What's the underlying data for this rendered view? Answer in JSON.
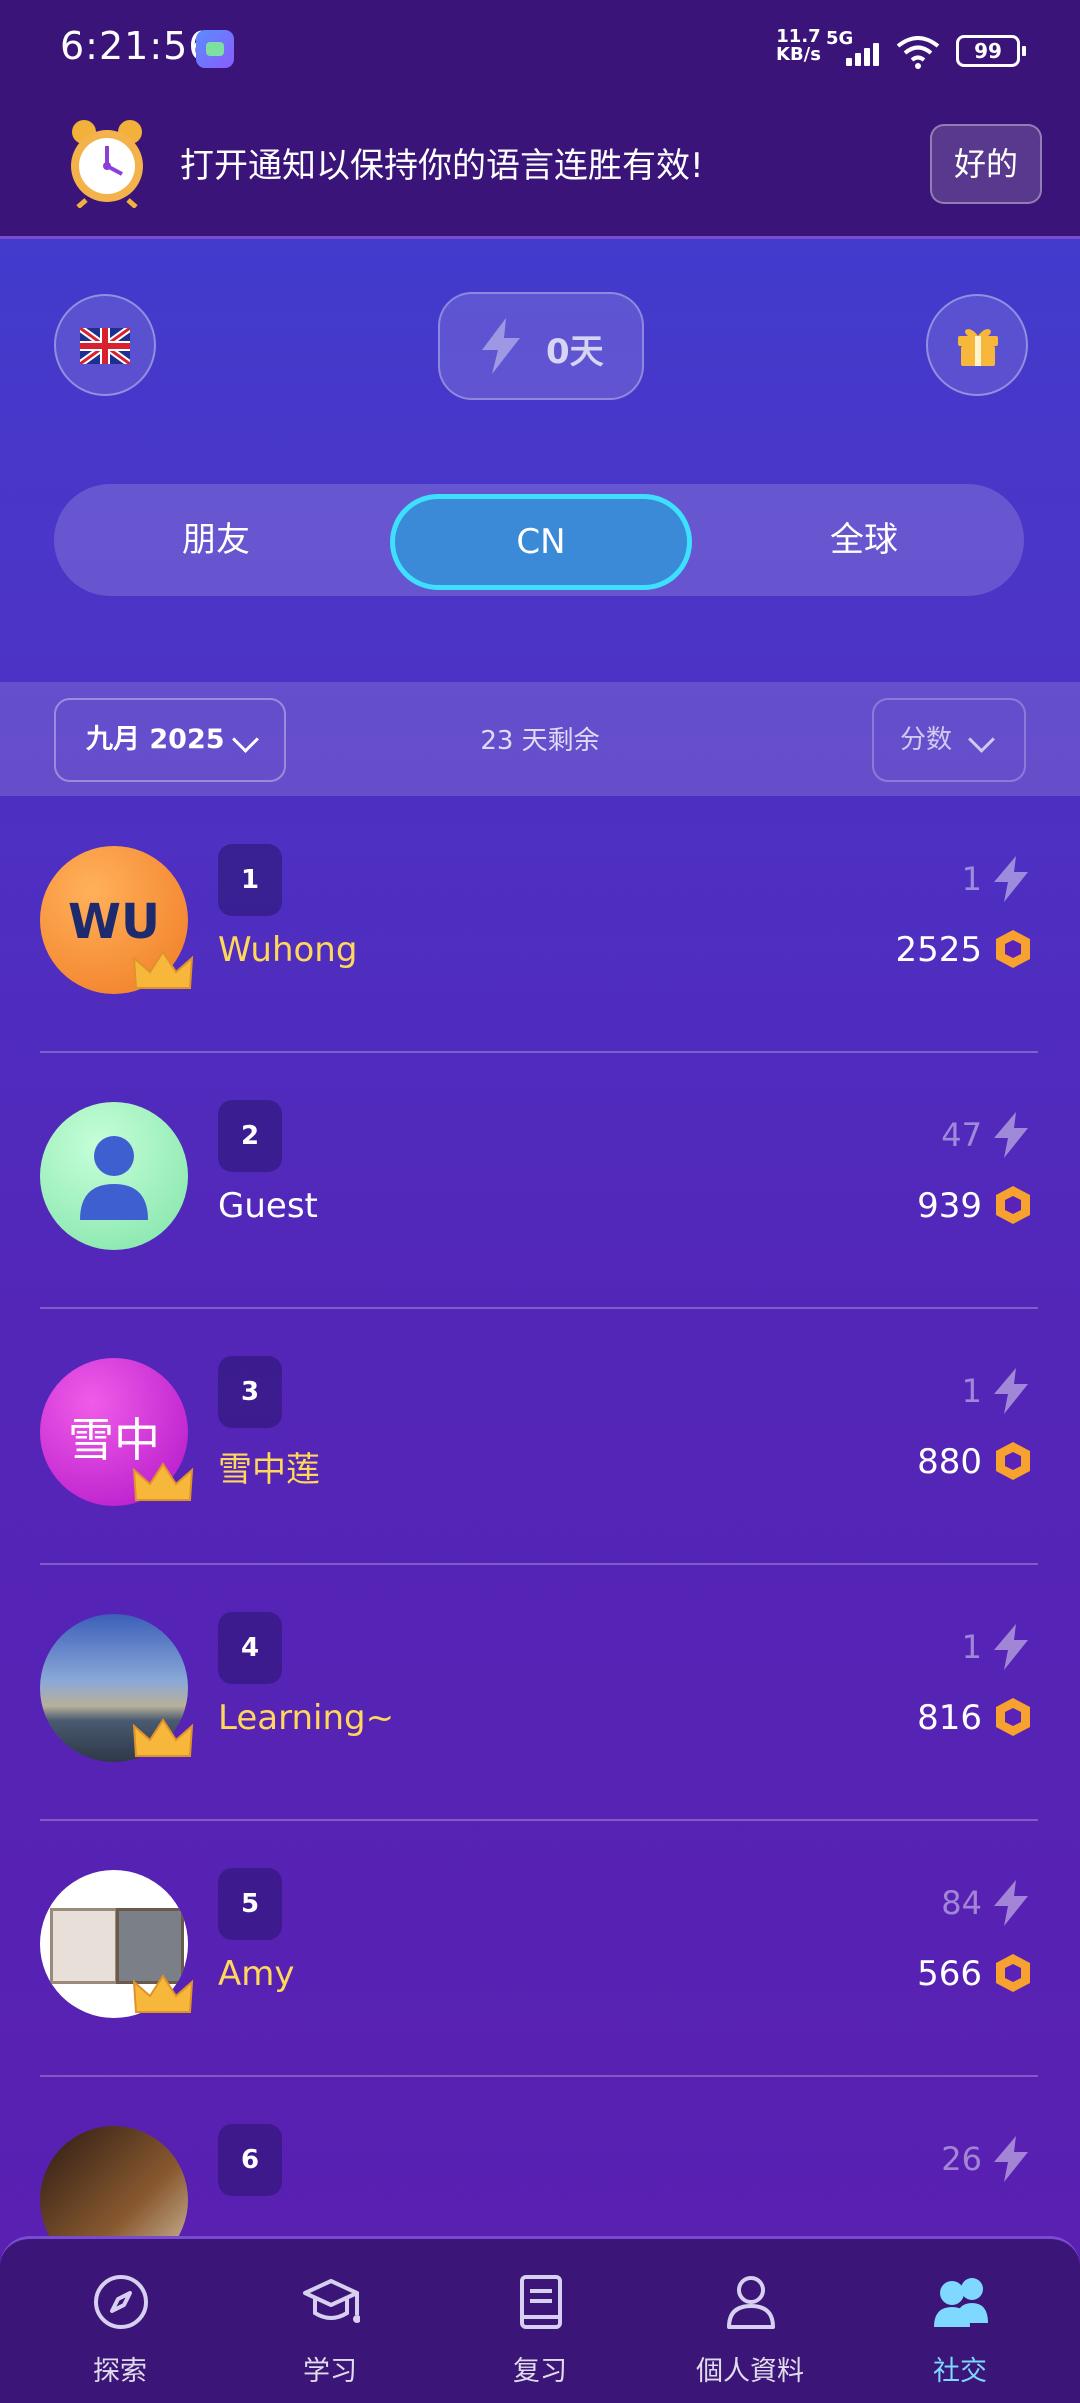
{
  "status_bar": {
    "time": "6:21:56",
    "net_speed_top": "11.7",
    "net_speed_unit": "KB/s",
    "network": "5G",
    "battery": "99"
  },
  "banner": {
    "message": "打开通知以保持你的语言连胜有效!",
    "ok_label": "好的"
  },
  "header": {
    "language_flag": "uk-flag-icon",
    "streak_label": "0天",
    "gift_icon": "gift-icon"
  },
  "tabs": [
    {
      "label": "朋友",
      "active": false
    },
    {
      "label": "CN",
      "active": true
    },
    {
      "label": "全球",
      "active": false
    }
  ],
  "filters": {
    "month_label": "九月 2025",
    "days_left": "23 天剩余",
    "sort_label": "分数"
  },
  "leaderboard": [
    {
      "rank": "1",
      "name": "Wuhong",
      "streak": "1",
      "score": "2525",
      "avatar_text": "WU",
      "crown": true,
      "gold": true
    },
    {
      "rank": "2",
      "name": "Guest",
      "streak": "47",
      "score": "939",
      "avatar_text": "",
      "crown": false,
      "gold": false
    },
    {
      "rank": "3",
      "name": "雪中莲",
      "streak": "1",
      "score": "880",
      "avatar_text": "雪中",
      "crown": true,
      "gold": true
    },
    {
      "rank": "4",
      "name": "Learning~",
      "streak": "1",
      "score": "816",
      "avatar_text": "",
      "crown": true,
      "gold": true
    },
    {
      "rank": "5",
      "name": "Amy",
      "streak": "84",
      "score": "566",
      "avatar_text": "",
      "crown": true,
      "gold": true
    },
    {
      "rank": "6",
      "name": "",
      "streak": "26",
      "score": "",
      "avatar_text": "",
      "crown": false,
      "gold": false
    }
  ],
  "bottom_nav": [
    {
      "label": "探索",
      "icon": "compass-icon",
      "active": false
    },
    {
      "label": "学习",
      "icon": "graduation-cap-icon",
      "active": false
    },
    {
      "label": "复习",
      "icon": "book-icon",
      "active": false
    },
    {
      "label": "個人資料",
      "icon": "person-icon",
      "active": false
    },
    {
      "label": "社交",
      "icon": "people-icon",
      "active": true
    }
  ],
  "colors": {
    "accent_gold": "#ffd75a",
    "coin_orange": "#f7a22e",
    "active_tab": "#3a8ad8",
    "active_tab_border": "#3ee0ff",
    "active_nav": "#7ed8ff"
  }
}
